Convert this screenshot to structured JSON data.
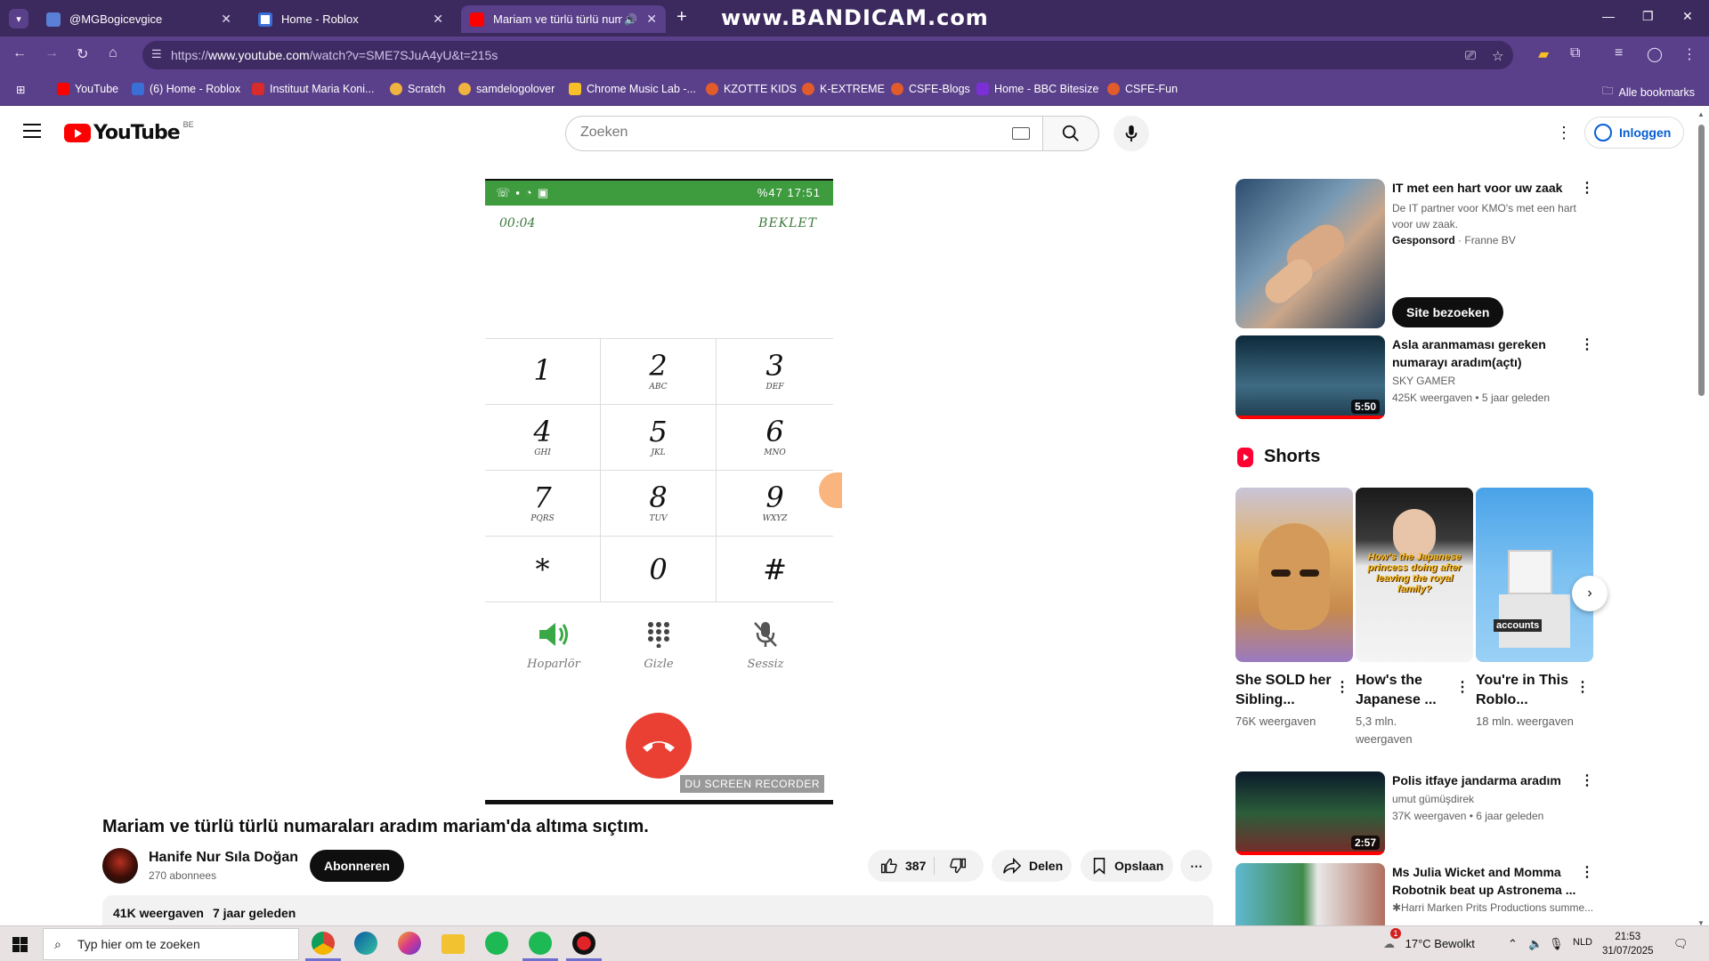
{
  "browser": {
    "tabs": [
      {
        "label": "@MGBogicevgice",
        "active": false
      },
      {
        "label": "Home - Roblox",
        "active": false
      },
      {
        "label": "Mariam ve türlü türlü numa",
        "active": true
      }
    ],
    "watermark": "www.BANDICAM.com",
    "url_prefix": "https://",
    "url_domain": "www.youtube.com",
    "url_path": "/watch?v=SME7SJuA4yU&t=215s",
    "bookmarks": [
      "YouTube",
      "(6) Home - Roblox",
      "Instituut Maria Koni...",
      "Scratch",
      "samdelogolover",
      "Chrome Music Lab -...",
      "KZOTTE KIDS",
      "K-EXTREME",
      "CSFE-Blogs",
      "Home - BBC Bitesize",
      "CSFE-Fun"
    ],
    "all_bookmarks": "Alle bookmarks"
  },
  "yt": {
    "logo_text": "YouTube",
    "country": "BE",
    "search_placeholder": "Zoeken",
    "signin": "Inloggen"
  },
  "phone": {
    "status_time": "%47 17:51",
    "timer": "00:04",
    "call_status": "BEKLET",
    "keys": [
      {
        "num": "1",
        "sub": ""
      },
      {
        "num": "2",
        "sub": "ABC"
      },
      {
        "num": "3",
        "sub": "DEF"
      },
      {
        "num": "4",
        "sub": "GHI"
      },
      {
        "num": "5",
        "sub": "JKL"
      },
      {
        "num": "6",
        "sub": "MNO"
      },
      {
        "num": "7",
        "sub": "PQRS"
      },
      {
        "num": "8",
        "sub": "TUV"
      },
      {
        "num": "9",
        "sub": "WXYZ"
      },
      {
        "num": "*",
        "sub": ""
      },
      {
        "num": "0",
        "sub": ""
      },
      {
        "num": "#",
        "sub": ""
      }
    ],
    "actions": [
      "Hoparlör",
      "Gizle",
      "Sessiz"
    ],
    "recorder": "DU SCREEN RECORDER"
  },
  "video": {
    "title": "Mariam ve türlü türlü numaraları aradım mariam'da altıma sıçtım.",
    "channel": "Hanife Nur Sıla Doğan",
    "subscribers": "270 abonnees",
    "subscribe": "Abonneren",
    "likes": "387",
    "share": "Delen",
    "save": "Opslaan",
    "views": "41K weergaven",
    "age": "7 jaar geleden"
  },
  "sidebar": {
    "ad": {
      "title": "IT met een hart voor uw zaak",
      "desc": "De IT partner voor KMO's met een hart voor uw zaak.",
      "sponsored": "Gesponsord",
      "advertiser": "Franne BV",
      "cta": "Site bezoeken"
    },
    "videos": [
      {
        "title": "Asla aranmaması gereken numarayı aradım(açtı)",
        "channel": "SKY GAMER",
        "meta": "425K weergaven • 5 jaar geleden",
        "duration": "5:50"
      },
      {
        "title": "Polis itfaye jandarma aradım",
        "channel": "umut gümüşdirek",
        "meta": "37K weergaven • 6 jaar geleden",
        "duration": "2:57"
      },
      {
        "title": "Ms Julia Wicket and Momma Robotnik beat up Astronema ...",
        "channel": "✱Harri Marken Prits Productions summe...",
        "meta": "",
        "duration": ""
      }
    ],
    "shorts_label": "Shorts",
    "shorts": [
      {
        "title": "She SOLD her Sibling...",
        "views": "76K weergaven",
        "overlay": ""
      },
      {
        "title": "How's the Japanese ...",
        "views": "5,3 mln. weergaven",
        "overlay": "How's the Japanese princess doing after leaving the royal family?"
      },
      {
        "title": "You're in This Roblo...",
        "views": "18 mln. weergaven",
        "overlay": "accounts"
      }
    ]
  },
  "taskbar": {
    "search_placeholder": "Typ hier om te zoeken",
    "weather": "17°C  Bewolkt",
    "lang": "NLD",
    "time": "21:53",
    "date": "31/07/2025",
    "notif_count": "1"
  },
  "colors": {
    "browser_tabbar": "#3c2a5e",
    "browser_toolbar": "#5a3f8a",
    "yt_red": "#ff0000",
    "phone_green": "#3e9b3e",
    "end_call_red": "#ea3f33"
  }
}
